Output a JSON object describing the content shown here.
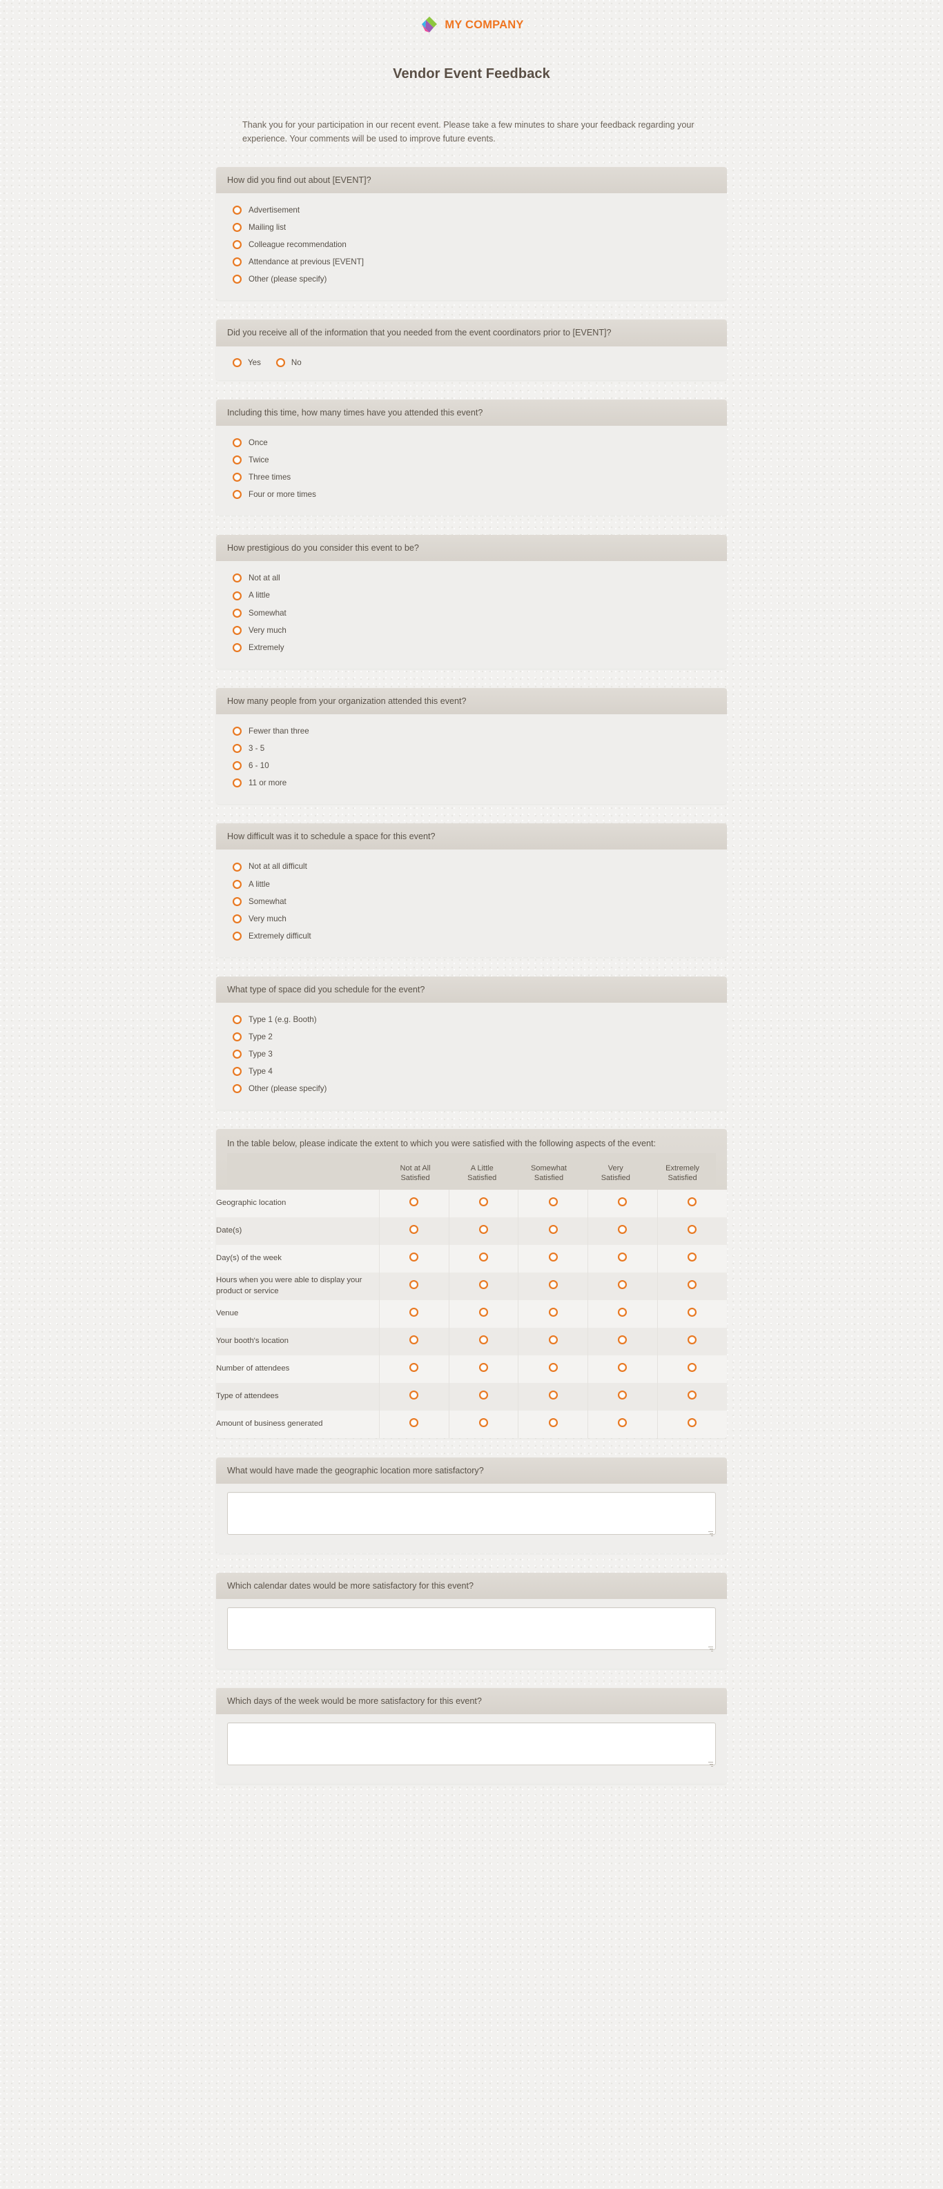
{
  "brand": {
    "name": "MY COMPANY",
    "logo_icon": "diamond-logo-icon",
    "accent_color": "#ef7521",
    "logo_colors": [
      "#8dc63f",
      "#39b4e8",
      "#9b59b6",
      "#ec4899"
    ]
  },
  "form": {
    "title": "Vendor Event Feedback",
    "intro": "Thank you for your participation in our recent event. Please take a few minutes to share your feedback regarding your experience. Your comments will be used to improve future events."
  },
  "questions": [
    {
      "id": "q1",
      "text": "How did you find out about [EVENT]?",
      "type": "radio",
      "layout": "vertical",
      "options": [
        "Advertisement",
        "Mailing list",
        "Colleague recommendation",
        "Attendance at previous [EVENT]",
        "Other (please specify)"
      ]
    },
    {
      "id": "q2",
      "text": "Did you receive all of the information that you needed from the event coordinators prior to [EVENT]?",
      "type": "radio",
      "layout": "inline",
      "options": [
        "Yes",
        "No"
      ]
    },
    {
      "id": "q3",
      "text": "Including this time, how many times have you attended this event?",
      "type": "radio",
      "layout": "vertical",
      "options": [
        "Once",
        "Twice",
        "Three times",
        "Four or more times"
      ]
    },
    {
      "id": "q4",
      "text": "How prestigious do you consider this event to be?",
      "type": "radio",
      "layout": "vertical",
      "options": [
        "Not at all",
        "A little",
        "Somewhat",
        "Very much",
        "Extremely"
      ]
    },
    {
      "id": "q5",
      "text": "How many people from your organization attended this event?",
      "type": "radio",
      "layout": "vertical",
      "options": [
        "Fewer than three",
        "3 - 5",
        "6 - 10",
        "11 or more"
      ]
    },
    {
      "id": "q6",
      "text": "How difficult was it to schedule a space for this event?",
      "type": "radio",
      "layout": "vertical",
      "options": [
        "Not at all difficult",
        "A little",
        "Somewhat",
        "Very much",
        "Extremely difficult"
      ]
    },
    {
      "id": "q7",
      "text": "What type of space did you schedule for the event?",
      "type": "radio",
      "layout": "vertical",
      "options": [
        "Type 1 (e.g. Booth)",
        "Type 2",
        "Type 3",
        "Type 4",
        "Other (please specify)"
      ]
    }
  ],
  "matrix": {
    "prompt": "In the table below, please indicate the extent to which you were satisfied with the following aspects of the event:",
    "columns": [
      {
        "line1": "Not at All",
        "line2": "Satisfied"
      },
      {
        "line1": "A Little",
        "line2": "Satisfied"
      },
      {
        "line1": "Somewhat",
        "line2": "Satisfied"
      },
      {
        "line1": "Very",
        "line2": "Satisfied"
      },
      {
        "line1": "Extremely",
        "line2": "Satisfied"
      }
    ],
    "rows": [
      "Geographic location",
      "Date(s)",
      "Day(s) of the week",
      "Hours when you were able to display your product or service",
      "Venue",
      "Your booth's location",
      "Number of attendees",
      "Type of attendees",
      "Amount of business generated"
    ]
  },
  "open_questions": [
    {
      "id": "oq1",
      "text": "What would have made the geographic location more satisfactory?",
      "value": "",
      "placeholder": ""
    },
    {
      "id": "oq2",
      "text": "Which calendar dates would be more satisfactory for this event?",
      "value": "",
      "placeholder": ""
    },
    {
      "id": "oq3",
      "text": "Which days of the week would be more satisfactory for this event?",
      "value": "",
      "placeholder": ""
    }
  ]
}
